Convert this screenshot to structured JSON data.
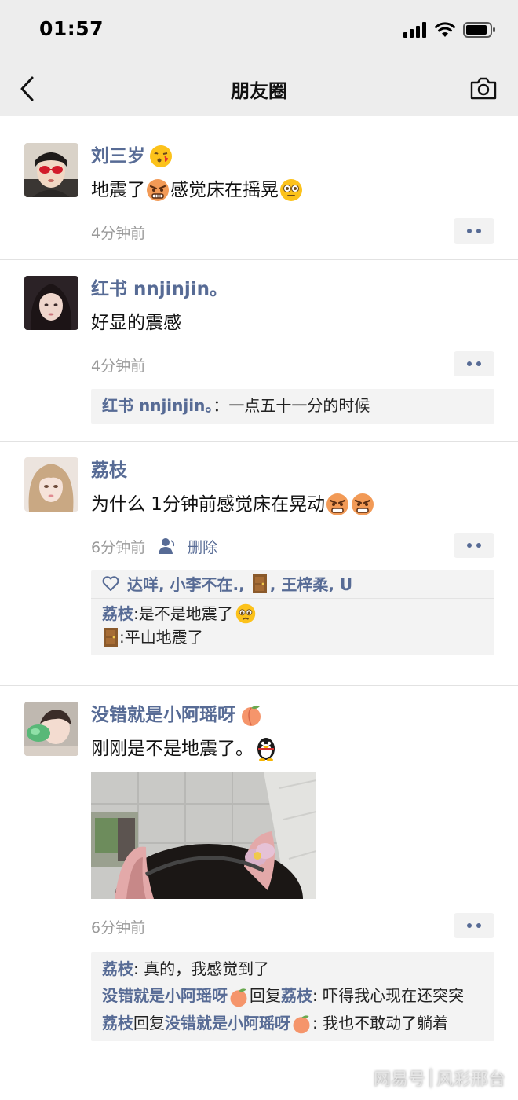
{
  "status_bar": {
    "time": "01:57",
    "icons": [
      "signal-icon",
      "wifi-icon",
      "battery-icon"
    ]
  },
  "nav": {
    "title": "朋友圈",
    "back_icon": "chevron-left-icon",
    "camera_icon": "camera-icon"
  },
  "colors": {
    "link": "#576b95",
    "bar_bg": "#ededed",
    "comment_bg": "#f3f3f3"
  },
  "posts": [
    {
      "author": "刘三岁",
      "author_emoji": "kissing-face-emoji",
      "text_parts": [
        "地震了",
        "感觉床在摇晃"
      ],
      "text_emojis": [
        "angry-face-emoji",
        "flushed-face-emoji"
      ],
      "time": "4分钟前"
    },
    {
      "author": "红书 nnjinjin。",
      "text": "好显的震感",
      "time": "4分钟前",
      "comments": [
        {
          "author": "红书 nnjinjin。",
          "sep": "：",
          "text": "一点五十一分的时候"
        }
      ]
    },
    {
      "author": "荔枝",
      "text": "为什么 1分钟前感觉床在晃动",
      "text_emojis": [
        "angry-face-emoji",
        "angry-face-emoji"
      ],
      "time": "6分钟前",
      "delete_label": "删除",
      "likes_pre": "达咩, 小李不在.,",
      "likes_post": ", 王梓柔, U",
      "comments": [
        {
          "author": "荔枝",
          "sep": ": ",
          "text": "是不是地震了"
        },
        {
          "author": "",
          "sep": ": ",
          "text": "平山地震了"
        }
      ]
    },
    {
      "author": "没错就是小阿瑶呀",
      "author_emoji": "peach-emoji",
      "text": "刚刚是不是地震了。",
      "time": "6分钟前",
      "comments": [
        {
          "author": "荔枝",
          "sep": ": ",
          "text": "真的，我感觉到了"
        },
        {
          "author": "没错就是小阿瑶呀",
          "reply_word": "回复",
          "reply_to": "荔枝",
          "sep": ": ",
          "text": "吓得我心现在还突突"
        },
        {
          "author": "荔枝",
          "reply_word": "回复",
          "reply_to": "没错就是小阿瑶呀",
          "sep": ": ",
          "text": "我也不敢动了躺着"
        }
      ]
    }
  ],
  "watermark": {
    "left": "网易号",
    "right": "风彩邢台"
  }
}
